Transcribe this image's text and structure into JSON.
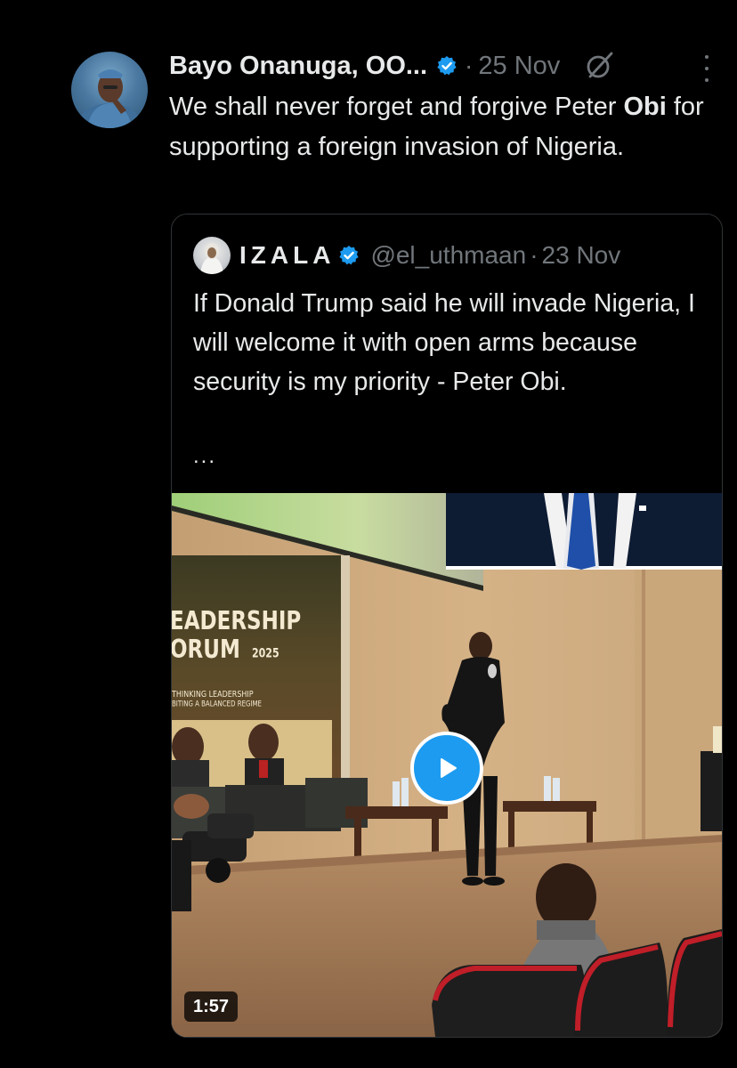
{
  "tweet": {
    "author_name": "Bayo Onanuga, OO...",
    "date": "25 Nov",
    "text_part1": "We shall never forget and forgive  Peter ",
    "text_bold": "Obi",
    "text_part2": " for supporting a foreign invasion of Nigeria.",
    "icons": [
      "verified-badge-icon",
      "grok-icon",
      "more-options-icon"
    ]
  },
  "quote": {
    "author_name": "IZALA",
    "handle": "@el_uthmaan",
    "date": "23 Nov",
    "text": "If Donald Trump said he will invade Nigeria, I will welcome it with open arms because security is my priority - Peter Obi.",
    "ellipsis": "...",
    "video": {
      "duration": "1:57",
      "banner_line1": "EADERSHIP",
      "banner_line2": "ORUM",
      "banner_year": "2025",
      "banner_small1": "THINKING LEADERSHIP",
      "banner_small2": "BITING A BALANCED REGIME"
    }
  },
  "colors": {
    "background": "#000000",
    "text": "#e7e9ea",
    "secondary_text": "#71767b",
    "verified_blue": "#1d9bf0",
    "card_border": "#2f3336"
  }
}
